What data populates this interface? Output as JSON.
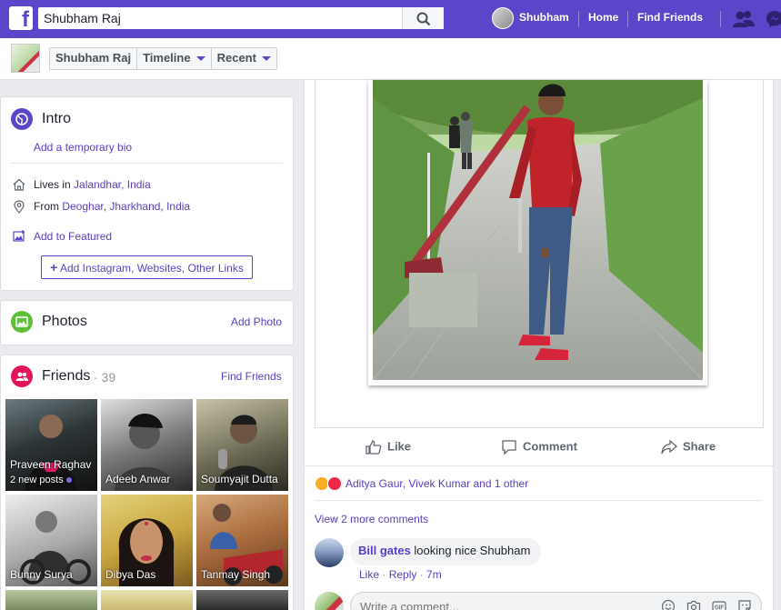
{
  "topbar": {
    "logo": "f",
    "search_value": "Shubham Raj",
    "search_icon": "search-icon",
    "user_name": "Shubham",
    "home_label": "Home",
    "find_friends_label": "Find Friends"
  },
  "subheader": {
    "tabs": [
      {
        "label": "Shubham Raj",
        "has_caret": false
      },
      {
        "label": "Timeline",
        "has_caret": true
      },
      {
        "label": "Recent",
        "has_caret": true
      }
    ]
  },
  "intro": {
    "title": "Intro",
    "add_bio": "Add a temporary bio",
    "lives_prefix": "Lives in ",
    "lives_place": "Jalandhar, India",
    "from_prefix": "From ",
    "from_place": "Deoghar, Jharkhand, India",
    "add_featured": "Add to Featured",
    "add_links": "Add Instagram, Websites, Other Links"
  },
  "photos": {
    "title": "Photos",
    "add_photo": "Add Photo"
  },
  "friends": {
    "title": "Friends",
    "count": "· 39",
    "find_friends": "Find Friends",
    "list": [
      {
        "name": "Praveen Raghav",
        "sub": "2 new posts"
      },
      {
        "name": "Adeeb Anwar"
      },
      {
        "name": "Soumyajit Dutta"
      },
      {
        "name": "Bunny Surya"
      },
      {
        "name": "Dibya Das"
      },
      {
        "name": "Tanmay Singh"
      }
    ]
  },
  "post": {
    "actions": {
      "like": "Like",
      "comment": "Comment",
      "share": "Share"
    },
    "reactions": {
      "names": "Aditya Gaur, Vivek Kumar and 1 other"
    },
    "view_more_comments": "View 2 more comments",
    "comment": {
      "author": "Bill gates",
      "text": " looking nice Shubham",
      "like": "Like",
      "sep": " · ",
      "reply": "Reply",
      "time": "7m"
    },
    "write_placeholder": "Write a comment..."
  },
  "colors": {
    "brand": "#5a46c8",
    "link": "#5b3cc4"
  }
}
